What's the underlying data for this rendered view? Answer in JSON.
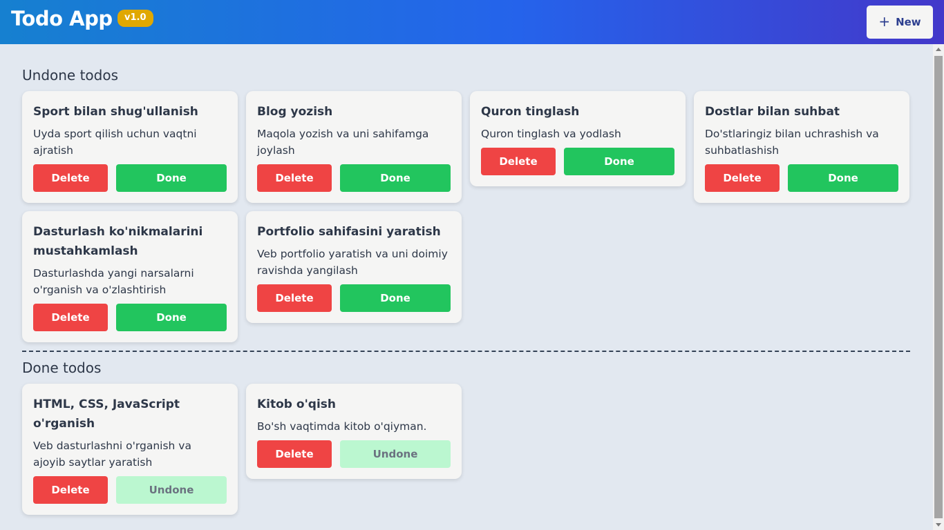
{
  "header": {
    "title": "Todo App",
    "version": "v1.0",
    "new_label": "New",
    "colors": {
      "gradient_start": "#1680d0",
      "gradient_end": "#4338ca",
      "badge": "#e0a800"
    }
  },
  "undone_section": {
    "title": "Undone todos",
    "todos": [
      {
        "title": "Sport bilan shug'ullanish",
        "desc": "Uyda sport qilish uchun vaqtni ajratish",
        "delete_label": "Delete",
        "toggle_label": "Done"
      },
      {
        "title": "Blog yozish",
        "desc": "Maqola yozish va uni sahifamga joylash",
        "delete_label": "Delete",
        "toggle_label": "Done"
      },
      {
        "title": "Quron tinglash",
        "desc": "Quron tinglash va yodlash",
        "delete_label": "Delete",
        "toggle_label": "Done"
      },
      {
        "title": "Dostlar bilan suhbat",
        "desc": "Do'stlaringiz bilan uchrashish va suhbatlashish",
        "delete_label": "Delete",
        "toggle_label": "Done"
      },
      {
        "title": "Dasturlash ko'nikmalarini mustahkamlash",
        "desc": "Dasturlashda yangi narsalarni o'rganish va o'zlashtirish",
        "delete_label": "Delete",
        "toggle_label": "Done"
      },
      {
        "title": "Portfolio sahifasini yaratish",
        "desc": "Veb portfolio yaratish va uni doimiy ravishda yangilash",
        "delete_label": "Delete",
        "toggle_label": "Done"
      }
    ]
  },
  "done_section": {
    "title": "Done todos",
    "todos": [
      {
        "title": "HTML, CSS, JavaScript o'rganish",
        "desc": "Veb dasturlashni o'rganish va ajoyib saytlar yaratish",
        "delete_label": "Delete",
        "toggle_label": "Undone"
      },
      {
        "title": "Kitob o'qish",
        "desc": "Bo'sh vaqtimda kitob o'qiyman.",
        "delete_label": "Delete",
        "toggle_label": "Undone"
      }
    ]
  },
  "colors": {
    "delete": "#ef4444",
    "done": "#22c55e",
    "undone": "#bbf7d0",
    "background": "#e2e8f0",
    "card": "#f5f5f4"
  }
}
